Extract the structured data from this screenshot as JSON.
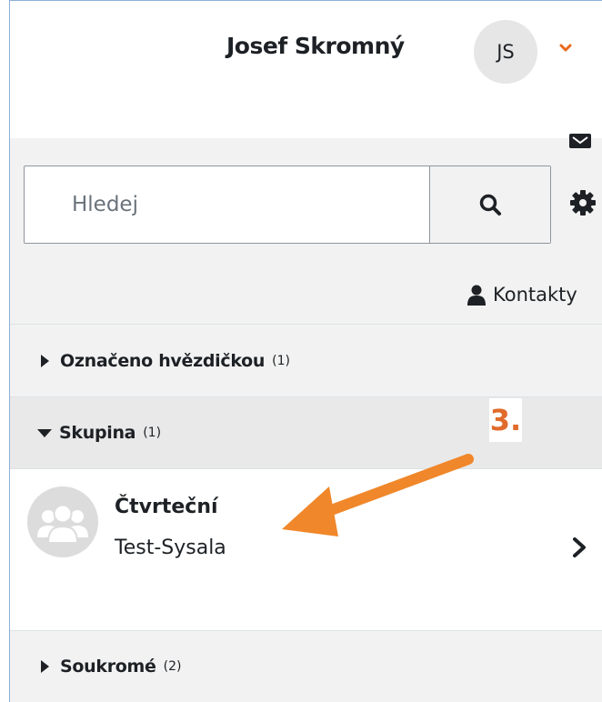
{
  "user": {
    "name": "Josef Skromný",
    "initials": "JS"
  },
  "search": {
    "placeholder": "Hledej"
  },
  "contacts_label": "Kontakty",
  "sections": {
    "starred": {
      "label": "Označeno hvězdičkou",
      "count": "(1)"
    },
    "group": {
      "label": "Skupina",
      "count": "(1)"
    },
    "private": {
      "label": "Soukromé",
      "count": "(2)"
    }
  },
  "conversation": {
    "name": "Čtvrteční",
    "subtitle": "Test-Sysala"
  },
  "annotation": {
    "label": "3."
  },
  "colors": {
    "accent": "#e8691e",
    "annotation": "#f0872a",
    "drawer_bg": "#f2f2f2",
    "text": "#1d2125"
  }
}
